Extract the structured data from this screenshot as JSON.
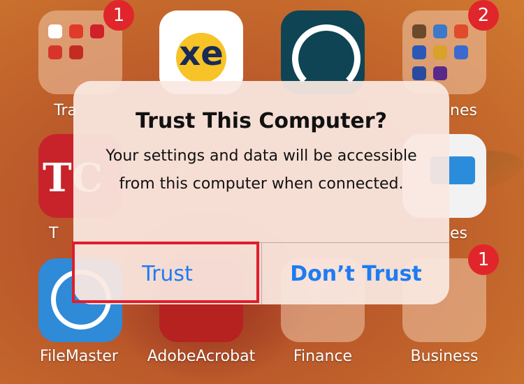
{
  "alert": {
    "title": "Trust This Computer?",
    "message": "Your settings and data will be accessible from this computer when connected.",
    "trust_label": "Trust",
    "dont_trust_label": "Don’t Trust",
    "button_color": "#1e7cf2"
  },
  "apps": {
    "travel_folder": {
      "label": "Tra",
      "badge": "1"
    },
    "xe": {
      "icon_text": "xe"
    },
    "games_folder": {
      "label": "nes",
      "badge": "2"
    },
    "row2_left": {
      "label": "T",
      "icon_text": "TC"
    },
    "row2_right": {
      "label": "es"
    },
    "filemaster": {
      "label": "FileMaster"
    },
    "adobe": {
      "label": "AdobeAcrobat"
    },
    "finance": {
      "label": "Finance"
    },
    "business": {
      "label": "Business",
      "badge": "1"
    }
  },
  "highlight_color": "#e11d2c"
}
